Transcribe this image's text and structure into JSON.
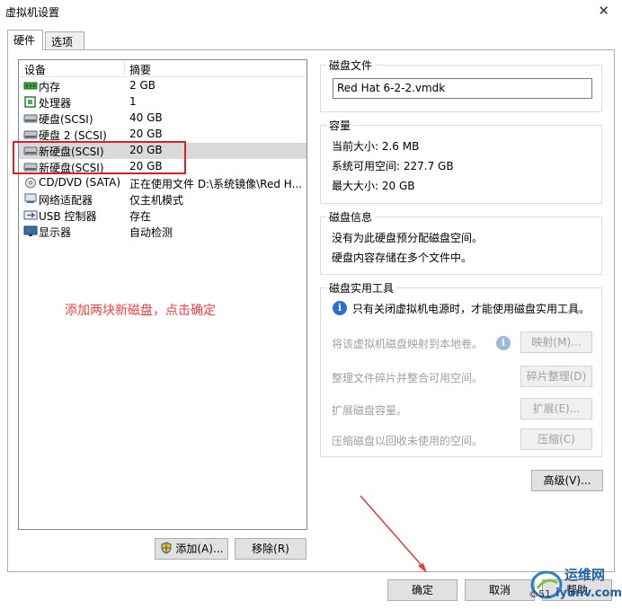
{
  "window": {
    "title": "虚拟机设置",
    "close_glyph": "✕"
  },
  "tabs": [
    {
      "label": "硬件"
    },
    {
      "label": "选项"
    }
  ],
  "devices": {
    "header": {
      "device": "设备",
      "summary": "摘要"
    },
    "rows": [
      {
        "name": "内存",
        "summary": "2 GB",
        "icon": "memory-icon"
      },
      {
        "name": "处理器",
        "summary": "1",
        "icon": "processor-icon"
      },
      {
        "name": "硬盘(SCSI)",
        "summary": "40 GB",
        "icon": "hard-disk-icon"
      },
      {
        "name": "硬盘 2 (SCSI)",
        "summary": "20 GB",
        "icon": "hard-disk-icon"
      },
      {
        "name": "新硬盘(SCSI)",
        "summary": "20 GB",
        "icon": "hard-disk-icon"
      },
      {
        "name": "新硬盘(SCSI)",
        "summary": "20 GB",
        "icon": "hard-disk-icon"
      },
      {
        "name": "CD/DVD (SATA)",
        "summary": "正在使用文件 D:\\系统镜像\\Red H...",
        "icon": "cd-dvd-icon"
      },
      {
        "name": "网络适配器",
        "summary": "仅主机模式",
        "icon": "network-adapter-icon"
      },
      {
        "name": "USB 控制器",
        "summary": "存在",
        "icon": "usb-icon"
      },
      {
        "name": "显示器",
        "summary": "自动检测",
        "icon": "display-icon"
      }
    ]
  },
  "annotation": "添加两块新磁盘，点击确定",
  "buttons": {
    "add": "添加(A)...",
    "remove": "移除(R)",
    "advanced": "高级(V)...",
    "ok": "确定",
    "cancel": "取消",
    "help": "帮助"
  },
  "disk_file": {
    "title": "磁盘文件",
    "value": "Red Hat 6-2-2.vmdk"
  },
  "capacity": {
    "title": "容量",
    "current": "当前大小: 2.6 MB",
    "available": "系统可用空间: 227.7 GB",
    "max": "最大大小: 20 GB"
  },
  "disk_info": {
    "title": "磁盘信息",
    "line1": "没有为此硬盘预分配磁盘空间。",
    "line2": "硬盘内容存储在多个文件中。"
  },
  "utilities": {
    "title": "磁盘实用工具",
    "note": "只有关闭虚拟机电源时，才能使用磁盘实用工具。",
    "map_label": "将该虚拟机磁盘映射到本地卷。",
    "map_button": "映射(M)...",
    "defrag_label": "整理文件碎片并整合可用空间。",
    "defrag_button": "碎片整理(D)",
    "expand_label": "扩展磁盘容量。",
    "expand_button": "扩展(E)...",
    "compact_label": "压缩磁盘以回收未使用的空间。",
    "compact_button": "压缩(C)"
  },
  "watermark": {
    "line1": "运维网",
    "line2": "iyunv.com",
    "prefix": "©51"
  },
  "colors": {
    "annotation": "#ff3b3b",
    "selection": "#d9d9d9",
    "highlight_box": "#e02020",
    "arrow": "#e53935"
  }
}
